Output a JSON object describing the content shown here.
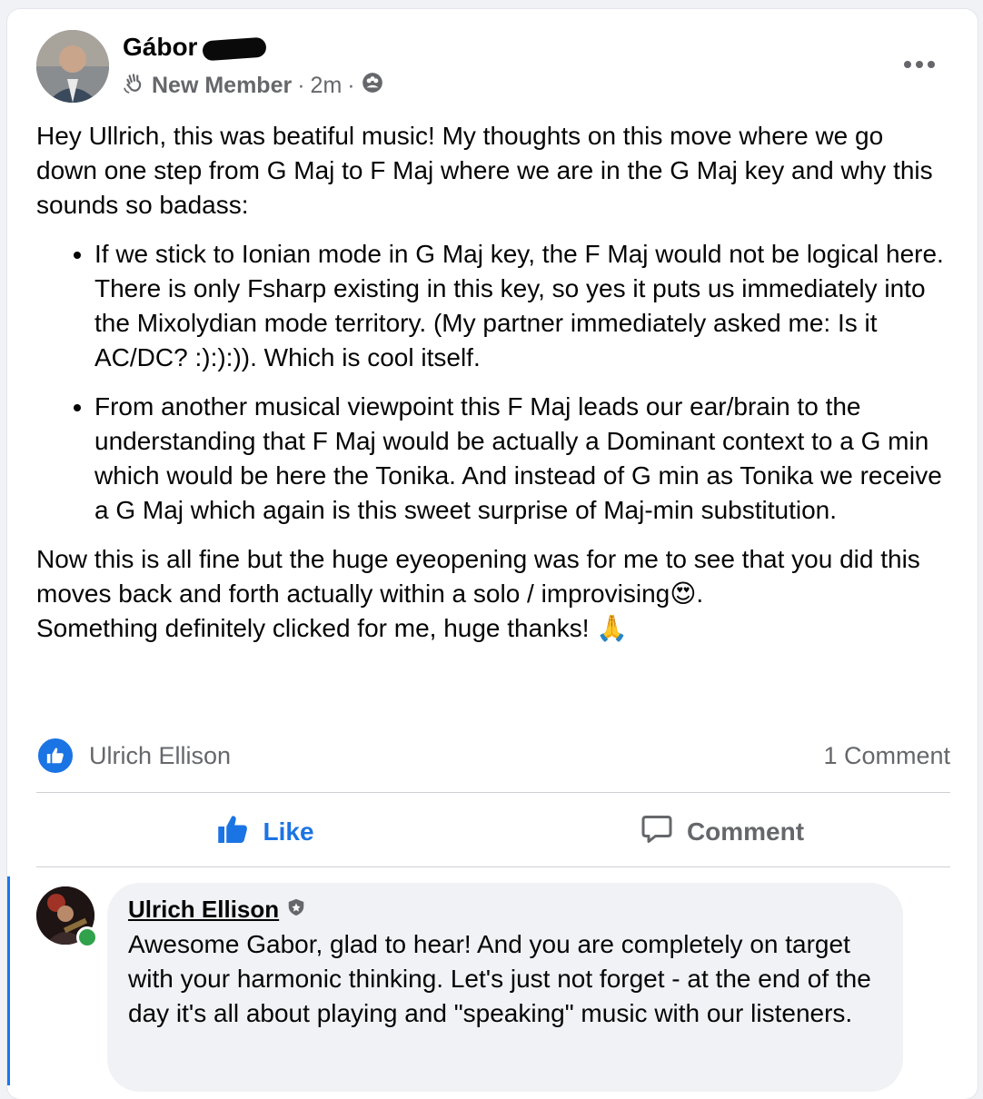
{
  "post": {
    "author_name": "Gábor",
    "badge_label": "New Member",
    "time": "2m",
    "separator": "·",
    "paragraphs": [
      "Hey Ullrich, this was beatiful music! My thoughts on this move where we go down one step from G Maj to F Maj where we are in the G Maj key and why this sounds so badass:"
    ],
    "bullets": [
      "If we stick to Ionian mode in G Maj key, the F Maj would not be logical here. There is only Fsharp existing in this key, so yes it puts us immediately into the Mixolydian mode territory. (My partner immediately asked me: Is it AC/DC? :):):)). Which is cool itself.",
      "From another musical viewpoint this F Maj leads our ear/brain to the understanding that F Maj would be actually a Dominant context to a G min which would be here the Tonika. And instead of G min as Tonika we receive a G Maj which again is this sweet surprise of Maj-min substitution."
    ],
    "closing_line1": "Now this is all fine but the huge eyeopening was for me to see that you did this moves back and forth actually within a solo / improvising",
    "closing_emoji1": "😍",
    "closing_line1_end": ".",
    "closing_line2": "Something definitely clicked for me, huge thanks! ",
    "closing_emoji2": "🙏"
  },
  "reactions": {
    "reactor_name": "Ulrich Ellison",
    "comment_count": "1 Comment"
  },
  "actions": {
    "like_label": "Like",
    "comment_label": "Comment"
  },
  "comment": {
    "author": "Ulrich Ellison",
    "text": "Awesome Gabor, glad to hear! And you are completely on target with your harmonic thinking. Let's just not forget - at the end of the day it's all about playing and \"speaking\" music with our listeners."
  },
  "icons": {
    "more": "more-options-icon",
    "new_member": "waving-hand-icon",
    "audience": "group-audience-icon",
    "like": "thumbs-up-icon",
    "comment": "speech-bubble-icon",
    "admin": "shield-badge-icon"
  },
  "colors": {
    "accent": "#1b74e4",
    "secondary_text": "#65676b",
    "online": "#31a24c"
  }
}
